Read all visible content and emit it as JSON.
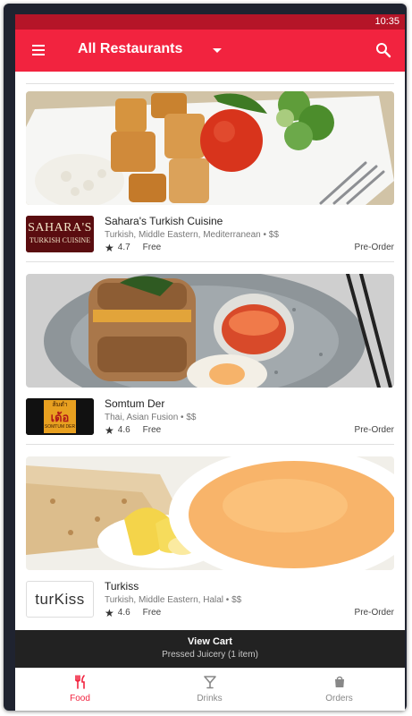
{
  "status": {
    "time": "10:35"
  },
  "header": {
    "title": "All Restaurants"
  },
  "restaurants": [
    {
      "name": "Sahara's Turkish Cuisine",
      "cuisine": "Turkish, Middle Eastern, Mediterranean • $$",
      "rating": "4.7",
      "fee": "Free",
      "order_type": "Pre-Order",
      "logo_line1": "SAHARA'S",
      "logo_line2": "TURKISH CUISINE"
    },
    {
      "name": "Somtum Der",
      "cuisine": "Thai, Asian Fusion • $$",
      "rating": "4.6",
      "fee": "Free",
      "order_type": "Pre-Order",
      "logo_line1": "ส้มตำ",
      "logo_line2": "เด้อ",
      "logo_line3": "SOMTUM DER"
    },
    {
      "name": "Turkiss",
      "cuisine": "Turkish, Middle Eastern, Halal • $$",
      "rating": "4.6",
      "fee": "Free",
      "order_type": "Pre-Order",
      "logo_line1": "turKiss"
    }
  ],
  "cart": {
    "title": "View Cart",
    "subtitle": "Pressed Juicery (1 item)"
  },
  "tabs": [
    {
      "label": "Food",
      "icon": "fork-knife-icon"
    },
    {
      "label": "Drinks",
      "icon": "cocktail-glass-icon"
    },
    {
      "label": "Orders",
      "icon": "shopping-bag-icon"
    }
  ],
  "colors": {
    "accent": "#f2233f",
    "statusbar": "#b51528",
    "cart_bar": "#222222"
  }
}
